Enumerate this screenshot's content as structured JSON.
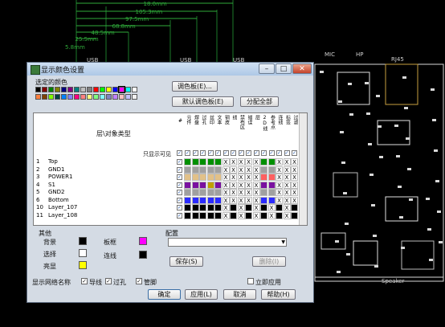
{
  "bg": {
    "dims": [
      "18.0mm",
      "105.3mm",
      "97.5mm",
      "68.8mm",
      "48.5mm",
      "25.5mm",
      "5.8mm"
    ],
    "labels": [
      "MIC",
      "HP",
      "RJ45",
      "USB",
      "USB",
      "USB",
      "Speaker"
    ]
  },
  "dialog": {
    "title": "显示颜色设置",
    "btn_min": "–",
    "btn_max": "□",
    "btn_close": "✕",
    "sel_color_label": "选定的颜色",
    "palette": [
      "#000000",
      "#800000",
      "#008000",
      "#808000",
      "#000080",
      "#800080",
      "#008080",
      "#c0c0c0",
      "#808080",
      "#ff0000",
      "#00ff00",
      "#ffff00",
      "#0000ff",
      "#ff00ff",
      "#00ffff",
      "#ffffff",
      "#ff8040",
      "#804000",
      "#80ff00",
      "#004040",
      "#0080ff",
      "#8080ff",
      "#ff0080",
      "#ff8080",
      "#ffff80",
      "#80ff80",
      "#80ffff",
      "#8080c0",
      "#c080ff",
      "#ffc0c0",
      "#c0c0ff",
      "#f0f0f0"
    ],
    "btn_palette": "调色板(E)...",
    "btn_default": "默认调色板(E)",
    "btn_assign_all": "分配全部",
    "layer_type_header": "层\\对象类型",
    "col_hash": "#",
    "columns": [
      "元件",
      "焊盘",
      "过孔",
      "丝印",
      "文本",
      "铜皮",
      "线",
      "禁布区",
      "错误",
      "层",
      "2D线",
      "参考点",
      "连线",
      "标签",
      "过滤"
    ],
    "only_visible_label": "只显示可见",
    "rows": [
      {
        "num": "1",
        "name": "Top"
      },
      {
        "num": "2",
        "name": "GND1"
      },
      {
        "num": "3",
        "name": "POWER1"
      },
      {
        "num": "4",
        "name": "S1"
      },
      {
        "num": "5",
        "name": "GND2"
      },
      {
        "num": "6",
        "name": "Bottom"
      },
      {
        "num": "10",
        "name": "Layer_107"
      },
      {
        "num": "11",
        "name": "Layer_108"
      }
    ],
    "row_colors": [
      "#009000",
      "#a0a0a0",
      "#e2c188",
      "#7a10a0",
      "#a0a0a0",
      "#2b2bff",
      "#000000",
      "#000000"
    ],
    "cell_mark": "X",
    "other_label": "其他",
    "bg_label": "背景",
    "bg_color": "#000000",
    "board_label": "板框",
    "board_color": "#ff00ff",
    "select_label": "选择",
    "select_color": "#ffffff",
    "link_label": "连线",
    "link_color": "#000000",
    "hilite_label": "亮显",
    "hilite_color": "#ffff00",
    "config_label": "配置",
    "config_value": "",
    "btn_save": "保存(S)",
    "btn_delete": "删除(I)",
    "net_names_label": "显示网络名称",
    "chk_traces": "导线",
    "chk_vias": "过孔",
    "chk_pins": "管脚",
    "chk_apply": "立即应用",
    "btn_ok": "确定",
    "btn_apply": "应用(L)",
    "btn_cancel": "取消",
    "btn_help": "帮助(H)"
  }
}
